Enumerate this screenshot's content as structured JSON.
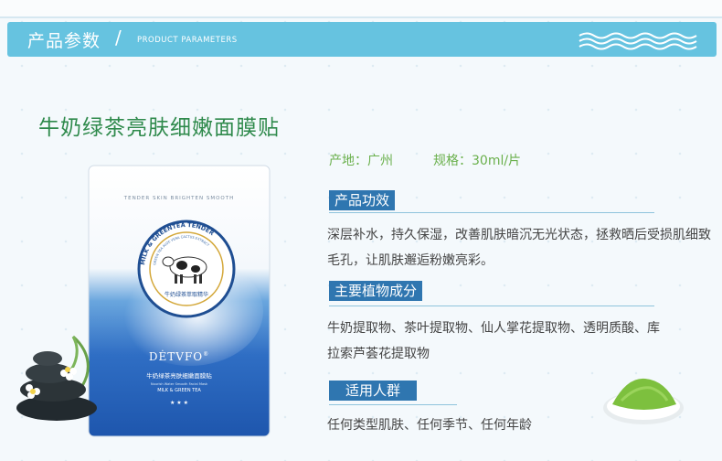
{
  "header": {
    "title_cn": "产品参数",
    "slash": "/",
    "title_en": "PRODUCT PARAMETERS"
  },
  "product": {
    "name": "牛奶绿茶亮肤细嫩面膜贴",
    "origin_label": "产地：",
    "origin_value": "广州",
    "spec_label": "规格：",
    "spec_value": "30ml/片"
  },
  "sections": [
    {
      "label": "产品功效",
      "text": "深层补水，持久保湿，改善肌肤暗沉无光状态，拯救晒后受损肌细致毛孔，让肌肤邂逅粉嫩亮彩。"
    },
    {
      "label": "主要植物成分",
      "text": "牛奶提取物、茶叶提取物、仙人掌花提取物、透明质酸、库拉索芦荟花提取物"
    },
    {
      "label": "适用人群",
      "text": "任何类型肌肤、任何季节、任何年龄"
    }
  ],
  "package": {
    "top_text": "TENDER SKIN BRIGHTEN SMOOTH",
    "seal_ring": "MILK & GREENTEA TENDER",
    "seal_inner": "GREEN TEA ALOE VERA CACTUS EXTRACT",
    "seal_cn": "牛奶绿茶萃取精华",
    "brand": "DĖTVFO",
    "brand_mark": "®",
    "line_cn": "牛奶绿茶亮肤细嫩面膜贴",
    "line_en_small": "Nourish Water Smooth Facial Mask",
    "line_en": "MILK & GREEN TEA"
  },
  "colors": {
    "header_bg": "#66c3e0",
    "title_green": "#2f8a4c",
    "label_blue": "#2f76b0",
    "info_green": "#6ab04c"
  }
}
